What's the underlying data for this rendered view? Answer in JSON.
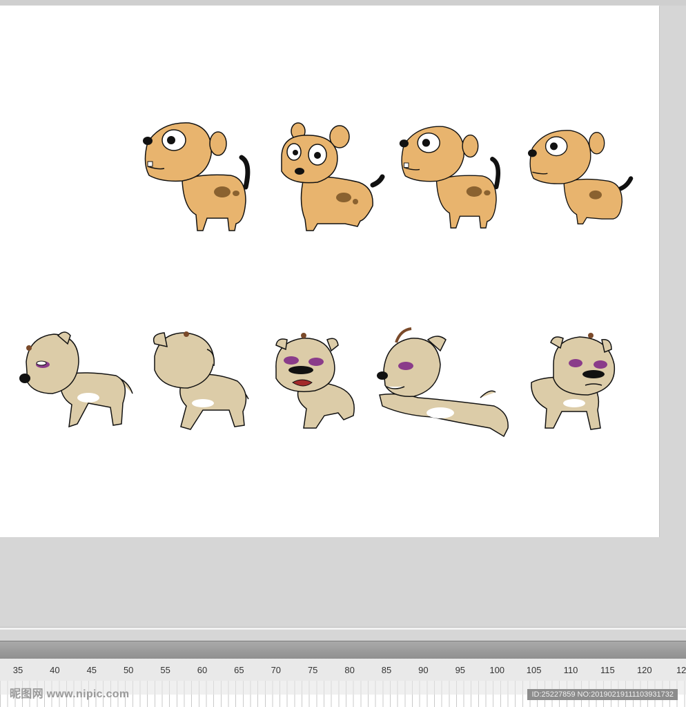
{
  "timeline": {
    "ruler_ticks": [
      "35",
      "40",
      "45",
      "50",
      "55",
      "60",
      "65",
      "70",
      "75",
      "80",
      "85",
      "90",
      "95",
      "100",
      "105",
      "110",
      "115",
      "120",
      "12"
    ]
  },
  "watermark": {
    "left": "昵图网 www.nipic.com",
    "right": "ID:25227859 NO:20190219111103931732"
  },
  "colors": {
    "stage": "#ffffff",
    "pasteboard": "#d6d6d6",
    "puppy_body": "#e8b46e",
    "puppy_spot": "#8a6230",
    "dog_body": "#dccca8",
    "outline": "#111111"
  },
  "sprites": {
    "row1": [
      "puppy-side-facing-left",
      "puppy-front",
      "puppy-side-facing-left",
      "puppy-side-facing-left"
    ],
    "row2": [
      "dog-side-walking",
      "dog-back-three-quarter",
      "dog-front-crying",
      "dog-jumping",
      "dog-front-sad"
    ]
  }
}
